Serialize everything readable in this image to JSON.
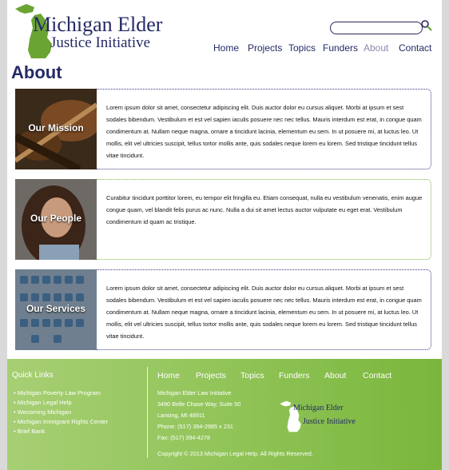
{
  "header": {
    "logo": {
      "line1": "Michigan Elder",
      "line2": "Justice Initiative"
    },
    "search": {
      "placeholder": ""
    },
    "nav": [
      {
        "label": "Home",
        "active": false
      },
      {
        "label": "Projects",
        "active": false
      },
      {
        "label": "Topics",
        "active": false
      },
      {
        "label": "Funders",
        "active": false
      },
      {
        "label": "About",
        "active": true
      },
      {
        "label": "Contact",
        "active": false
      }
    ]
  },
  "page": {
    "title": "About"
  },
  "cards": [
    {
      "label": "Our Mission",
      "text": "Lorem ipsum dolor sit amet, consectetur adipiscing elit. Duis auctor dolor eu cursus aliquet. Morbi at ipsum et sest sodales bibendum. Vestibulum et est vel sapien iaculis posuere nec nec tellus. Mauris interdum est erat, in congue quam condimentum at. Nullam neque magna, ornare a tincidunt lacinia, elementum eu sem. In ut posuere mi, at luctus leo. Ut mollis, elit vel ultricies suscipit, tellus tortor mollis ante, quis sodales neque lorem eu lorem. Sed tristique tincidunt tellus vitae tincidunt."
    },
    {
      "label": "Our People",
      "text": "Curabitur tincidunt porttitor lorem, eu tempor elit fringilla eu. Etiam consequat, nulla eu vestibulum venenatis, enim augue congue quam, vel blandit felis purus ac nunc. Nulla a dui sit amet lectus auctor vulputate eu eget erat. Vestibulum condimentum id quam ac tristique."
    },
    {
      "label": "Our Services",
      "text": "Lorem ipsum dolor sit amet, consectetur adipiscing elit. Duis auctor dolor eu cursus aliquet. Morbi at ipsum et sest sodales bibendum. Vestibulum et est vel sapien iaculis posuere nec nec tellus. Mauris interdum est erat, in congue quam condimentum at. Nullam neque magna, ornare a tincidunt lacinia, elementum eu sem. In ut posuere mi, at luctus leo. Ut mollis, elit vel ultricies suscipit, tellus tortor mollis ante, quis sodales neque lorem eu lorem. Sed tristique tincidunt tellus vitae tincidunt."
    }
  ],
  "footer": {
    "quick_links_title": "Quick Links",
    "quick_links": [
      "Michigan Poverty Law Program",
      "Michigan Legal Help",
      "Wecoming Michigan",
      "Michigan Immigrant Rights Center",
      "Brief Bank"
    ],
    "nav": [
      "Home",
      "Projects",
      "Topics",
      "Funders",
      "About",
      "Contact"
    ],
    "address": [
      "Michigan Elder Law Initiative",
      "3490 Belle Chase Way, Suite 50",
      "Lansing, MI 48911",
      "Phone: (517) 394-2985 x 231",
      "Fax:  (517) 394-4278"
    ],
    "copyright": "Copyright © 2013 Michigan Legal Help. All Rights Reserved.",
    "logo": {
      "line1": "Michigan Elder",
      "line2": "Justice Initiative"
    }
  },
  "colors": {
    "brand_navy": "#242a66",
    "brand_green": "#6aa532",
    "footer_green": "#8fc356"
  }
}
